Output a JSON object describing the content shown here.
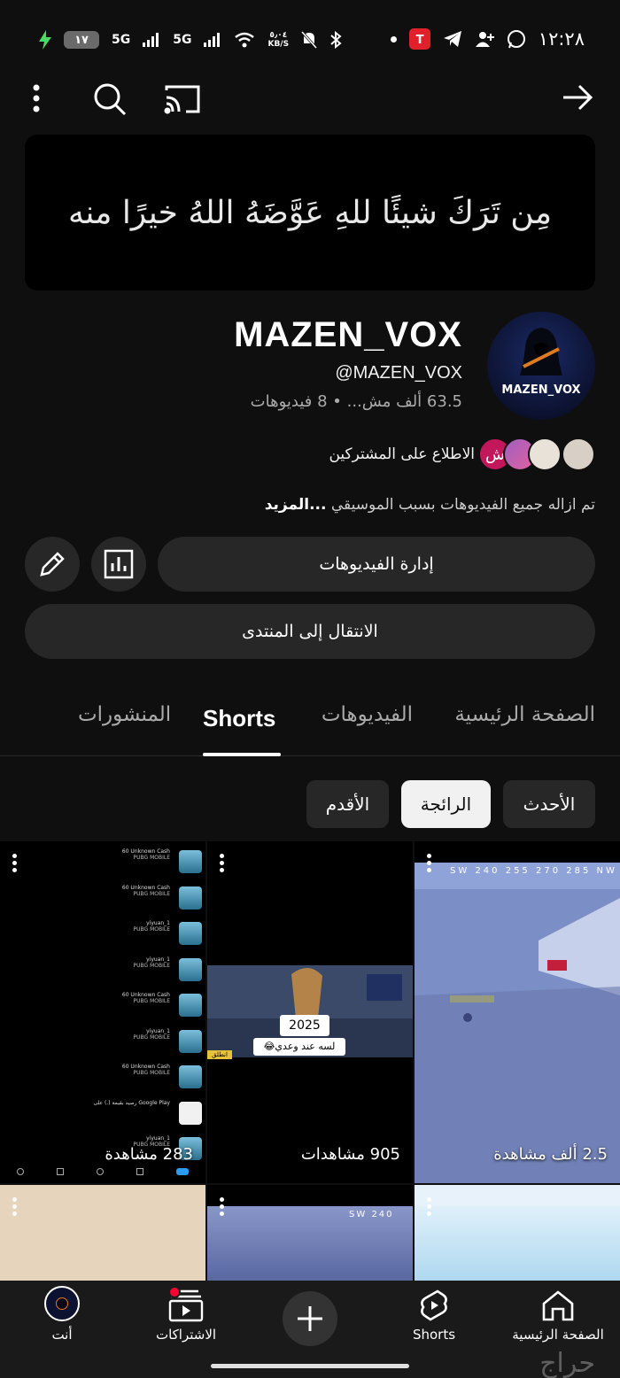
{
  "status": {
    "time": "١٢:٢٨",
    "battery": "١٧",
    "net1": "5G",
    "net2": "5G",
    "speed_top": "٥٫٠٤",
    "speed_unit": "KB/S"
  },
  "banner_text": "مِن تَرَكَ شيئًا للهِ عَوَّضَهُ اللهُ خيرًا منه",
  "channel": {
    "avatar_text": "MAZEN_VOX",
    "name": "MAZEN_VOX",
    "handle": "@MAZEN_VOX",
    "meta": "63.5 ألف مش... • 8 فيديوهات",
    "subs_link": "الاطلاع على المشتركين",
    "face_letter": "ش",
    "description": "تم ازاله جميع الفيديوهات بسبب الموسيقي ",
    "more": "...المزيد"
  },
  "buttons": {
    "manage": "إدارة الفيديوهات",
    "community": "الانتقال إلى المنتدى"
  },
  "tabs": [
    "الصفحة الرئيسية",
    "الفيديوهات",
    "Shorts",
    "المنشورات"
  ],
  "chips": [
    "الأحدث",
    "الرائجة",
    "الأقدم"
  ],
  "shorts": [
    {
      "views": "2.5 ألف مشاهدة"
    },
    {
      "views": "905 مشاهدات",
      "year": "2025",
      "caption": "لسه عند وعدي😂",
      "btn": "انطلق"
    },
    {
      "views": "283 مشاهدة"
    }
  ],
  "list_items": [
    {
      "name": "60 Unknown Cash",
      "game": "PUBG MOBILE"
    },
    {
      "name": "60 Unknown Cash",
      "game": "PUBG MOBILE"
    },
    {
      "name": "yiyuan_1",
      "game": "PUBG MOBILE"
    },
    {
      "name": "yiyuan_1",
      "game": "PUBG MOBILE"
    },
    {
      "name": "60 Unknown Cash",
      "game": "PUBG MOBILE"
    },
    {
      "name": "yiyuan_1",
      "game": "PUBG MOBILE"
    },
    {
      "name": "60 Unknown Cash",
      "game": "PUBG MOBILE"
    },
    {
      "name": "رصيد بقيمة (.) على Google Play",
      "game": ""
    },
    {
      "name": "yiyuan_1",
      "game": "PUBG MOBILE"
    }
  ],
  "compass": {
    "sw": "SW",
    "nw": "NW",
    "n240": "240",
    "n285": "285"
  },
  "nav": [
    "الصفحة الرئيسية",
    "Shorts",
    "",
    "الاشتراكات",
    "أنت"
  ],
  "watermark": "حراج",
  "colors": {
    "bg": "#0f0f0f",
    "button": "#272727",
    "accent_red": "#ff0033"
  }
}
